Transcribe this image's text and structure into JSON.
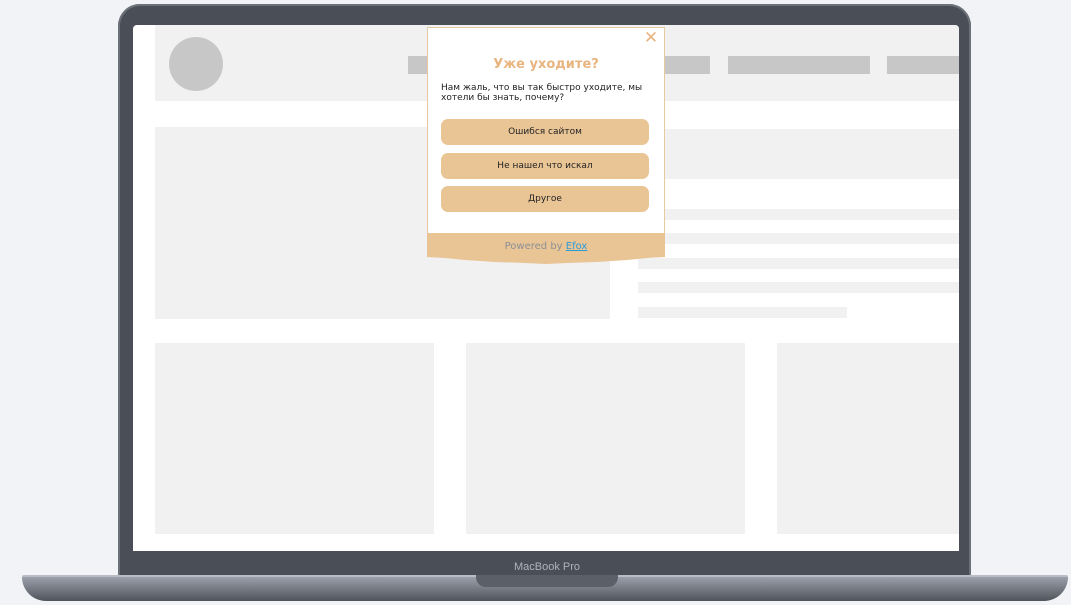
{
  "device": {
    "label": "MacBook Pro"
  },
  "popup": {
    "title": "Уже уходите?",
    "message": "Нам жаль, что вы так быстро уходите, мы хотели бы знать, почему?",
    "options": [
      {
        "label": "Ошибся сайтом"
      },
      {
        "label": "Не нашел что искал"
      },
      {
        "label": "Другое"
      }
    ],
    "footer": {
      "prefix": "Powered by",
      "link": "Efox"
    }
  },
  "colors": {
    "accent": "#e8b47f",
    "button_bg": "#e9c596",
    "placeholder_light": "#f1f1f1",
    "placeholder_dark": "#c7c7c7",
    "link": "#2a9ad8"
  }
}
